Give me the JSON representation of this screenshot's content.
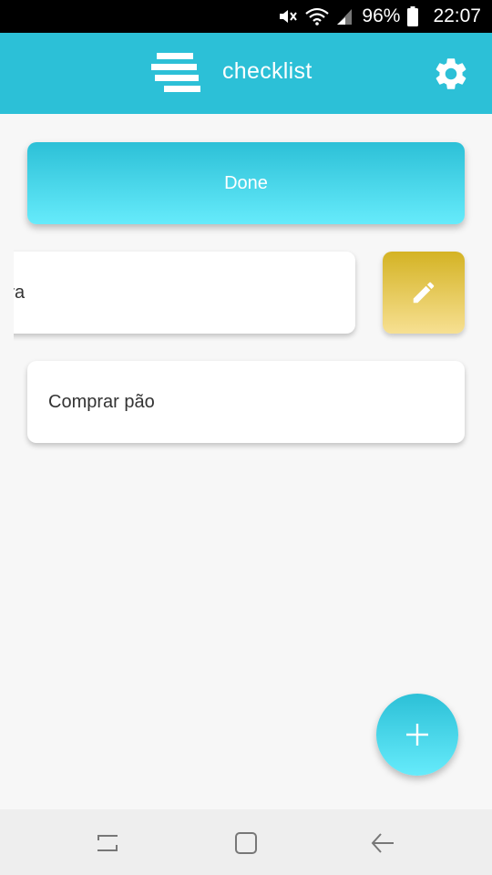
{
  "status_bar": {
    "battery": "96%",
    "time": "22:07",
    "icons": [
      "mute-icon",
      "wifi-icon",
      "signal-icon",
      "battery-icon"
    ]
  },
  "app_bar": {
    "title": "checklist",
    "logo_icon": "stacked-bars-logo",
    "settings_icon": "gear-icon"
  },
  "done_button": {
    "label": "Done"
  },
  "tasks": [
    {
      "label": "o fora",
      "state": "swiped-left"
    },
    {
      "label": "Comprar pão",
      "state": "normal"
    }
  ],
  "edit_action": {
    "icon": "pencil-icon"
  },
  "fab": {
    "icon": "plus-icon"
  },
  "nav_bar": {
    "buttons": [
      "recents-icon",
      "home-icon",
      "back-icon"
    ]
  },
  "colors": {
    "primary": "#2cc0d7",
    "primary_light": "#66ebfb",
    "edit_dark": "#d4b324",
    "edit_light": "#f7e092",
    "background": "#f7f7f7"
  }
}
